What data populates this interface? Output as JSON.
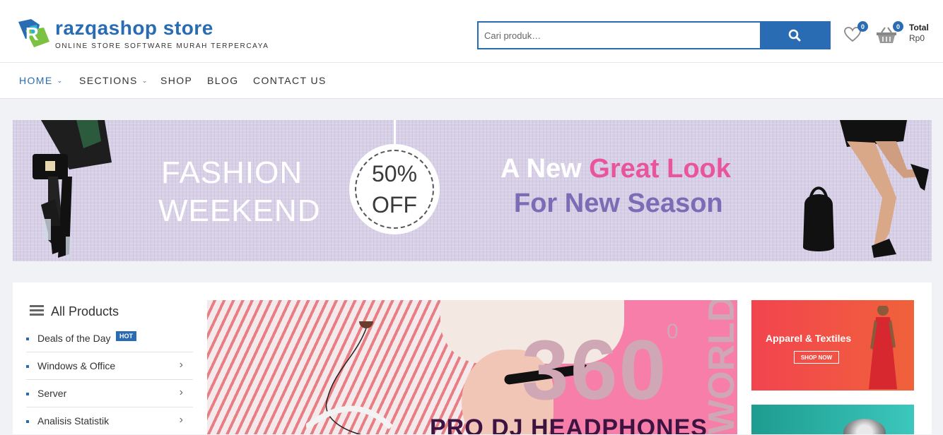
{
  "header": {
    "site_title": "razqashop store",
    "tagline": "ONLINE STORE SOFTWARE MURAH TERPERCAYA",
    "search_placeholder": "Cari produk…",
    "wishlist_count": "0",
    "cart_count": "0",
    "total_label": "Total",
    "total_value": "Rp0"
  },
  "nav": {
    "items": [
      {
        "label": "HOME"
      },
      {
        "label": "SECTIONS"
      },
      {
        "label": "SHOP"
      },
      {
        "label": "BLOG"
      },
      {
        "label": "CONTACT US"
      }
    ]
  },
  "hero": {
    "line1": "FASHION",
    "line2": "WEEKEND",
    "badge_percent": "50%",
    "badge_off": "OFF",
    "tagline_part1": "A New ",
    "tagline_part2": "Great Look",
    "tagline_line2": "For New Season"
  },
  "categories": {
    "title": "All Products",
    "hot_badge": "HOT",
    "items": [
      {
        "label": "Deals of the Day"
      },
      {
        "label": "Windows & Office"
      },
      {
        "label": "Server"
      },
      {
        "label": "Analisis Statistik"
      }
    ]
  },
  "promo_main": {
    "big_number": "360",
    "degree": "0",
    "side_word": "WORLD",
    "headline": "PRO DJ HEADPHONES"
  },
  "promo_side": {
    "title": "Apparel & Textiles",
    "button": "SHOP NOW"
  },
  "colors": {
    "brand_blue": "#2a6cb4",
    "hero_bg": "#d7d0e6",
    "hero_pink": "#e9559c",
    "hero_purple": "#7c6bb5"
  }
}
